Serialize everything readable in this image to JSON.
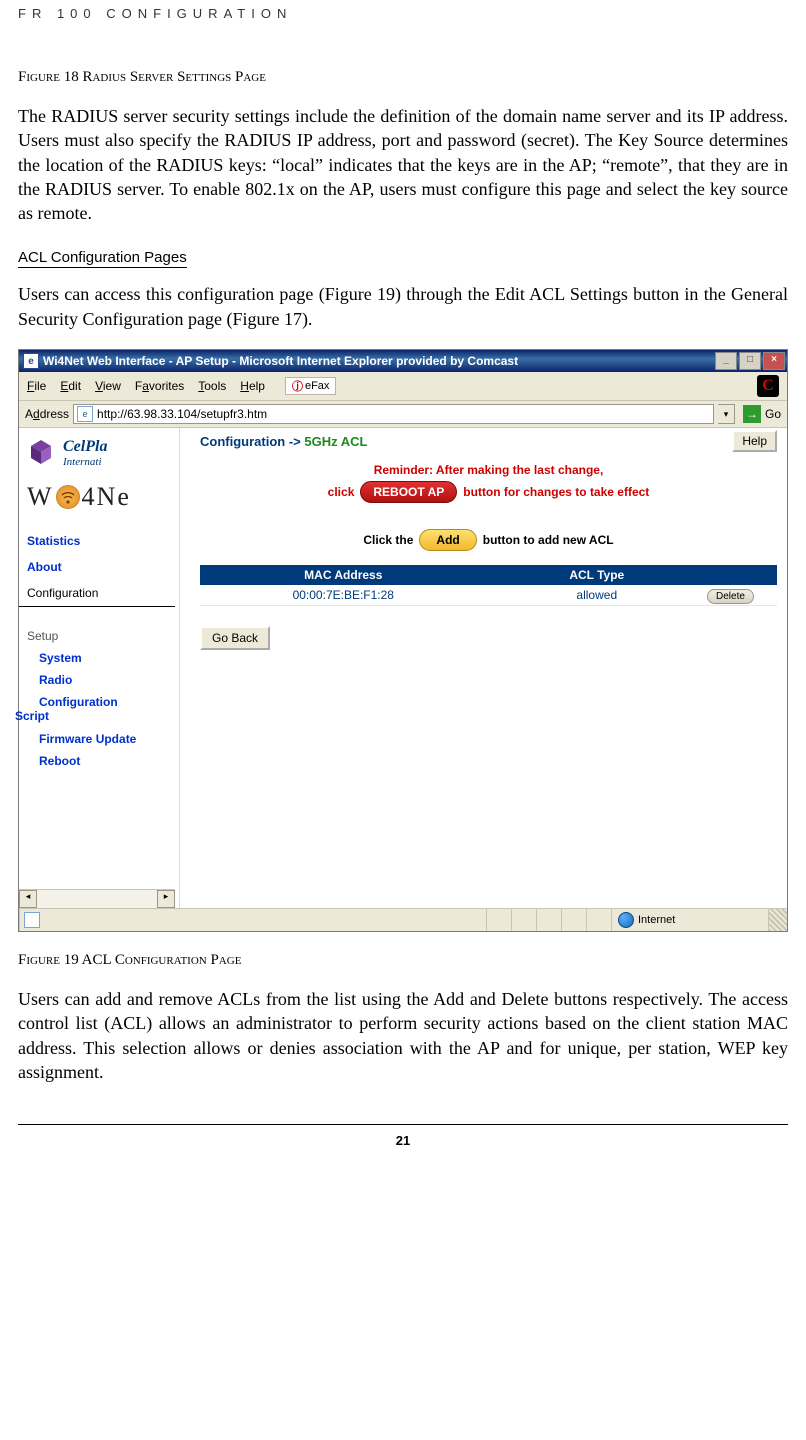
{
  "doc": {
    "header": "FR 100 CONFIGURATION",
    "fig18": "Figure 18 Radius Server Settings Page",
    "para1": "The RADIUS server security settings include the definition of the domain name server and its IP address. Users must also specify the RADIUS IP address, port and password (secret). The Key Source determines the location of the RADIUS keys: “local” indicates that the keys are in the AP; “remote”, that they are in the RADIUS server. To enable 802.1x on the AP, users must configure this page and select the key source as remote.",
    "section": "ACL Configuration Pages",
    "para2": "Users can access this configuration page (Figure 19) through the Edit ACL Settings button in the General Security Configuration page (Figure 17).",
    "fig19": "Figure 19 ACL Configuration Page",
    "para3": "Users can add and remove ACLs from the list using the Add and Delete buttons respectively. The access control list (ACL) allows an administrator to perform security actions based on the client station MAC address. This selection allows or denies association with the AP and for unique, per station, WEP key assignment.",
    "pagenum": "21"
  },
  "browser": {
    "title": "Wi4Net Web Interface - AP Setup - Microsoft Internet Explorer provided by Comcast",
    "menu": {
      "file": "File",
      "edit": "Edit",
      "view": "View",
      "favorites": "Favorites",
      "tools": "Tools",
      "help": "Help",
      "efax": "eFax"
    },
    "address_label": "Address",
    "url": "http://63.98.33.104/setupfr3.htm",
    "go": "Go",
    "status_zone": "Internet"
  },
  "app": {
    "brand": {
      "celplan1": "CelPla",
      "celplan2": "Internati",
      "wi4net_w": "W",
      "wi4net_rest": "4Ne"
    },
    "nav": {
      "statistics": "Statistics",
      "about": "About",
      "configuration": "Configuration",
      "setup": "Setup",
      "system": "System",
      "radio": "Radio",
      "confscript1": "Configuration",
      "confscript2": "Script",
      "firmware": "Firmware Update",
      "reboot": "Reboot"
    },
    "crumb": {
      "c1": "Configuration",
      "arrow": " -> ",
      "c2": "5GHz ACL"
    },
    "help": "Help",
    "reminder_line1": "Reminder: After making the last change,",
    "reminder_click": "click",
    "reboot_btn": "REBOOT AP",
    "reminder_line2_rest": "button for changes to take effect",
    "addrow_pre": "Click the",
    "add_btn": "Add",
    "addrow_post": "button to add new ACL",
    "table": {
      "h1": "MAC Address",
      "h2": "ACL Type",
      "rows": [
        {
          "mac": "00:00:7E:BE:F1:28",
          "type": "allowed"
        }
      ],
      "delete": "Delete"
    },
    "goback": "Go Back"
  }
}
